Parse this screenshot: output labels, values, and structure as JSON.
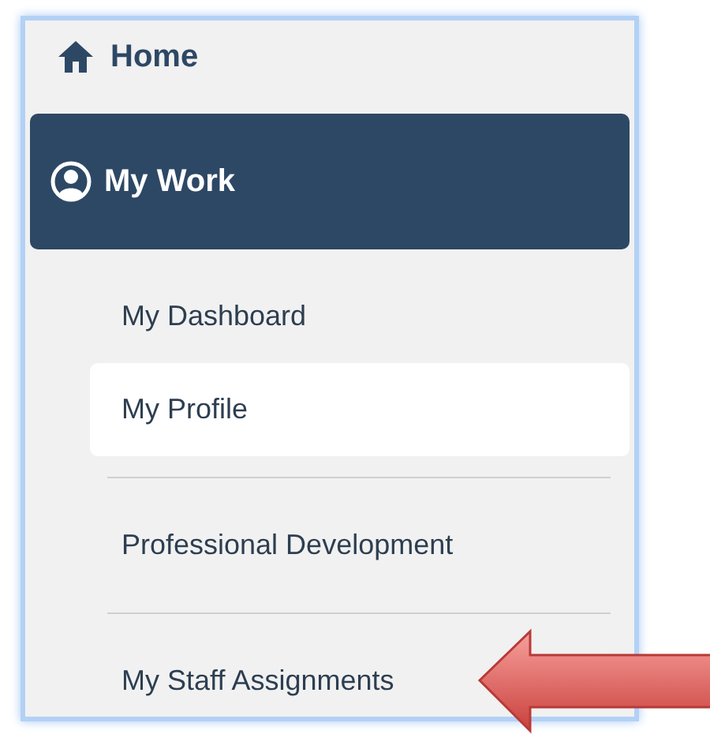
{
  "nav": [
    {
      "label": "Home",
      "kind": "link",
      "selected": false
    },
    {
      "label": "My Work",
      "kind": "section",
      "selected": true,
      "children": [
        {
          "label": "My Dashboard",
          "selected": false
        },
        {
          "label": "My Profile",
          "selected": true
        },
        {
          "label": "Professional Development",
          "selected": false
        },
        {
          "label": "My Staff Assignments",
          "selected": false
        }
      ]
    }
  ]
}
